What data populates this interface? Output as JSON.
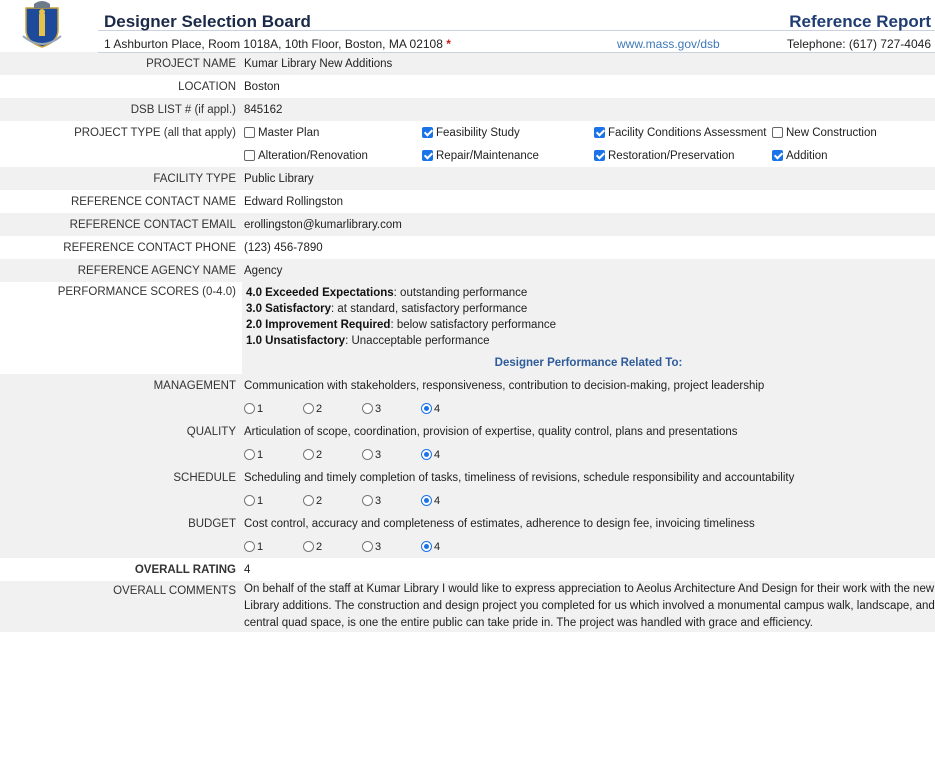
{
  "header": {
    "board_title": "Designer Selection Board",
    "report_title": "Reference Report",
    "address": "1 Ashburton Place, Room 1018A, 10th Floor, Boston, MA 02108",
    "asterisk": "*",
    "website": "www.mass.gov/dsb",
    "phone": "Telephone: (617) 727-4046"
  },
  "fields": {
    "project_name": {
      "label": "PROJECT NAME",
      "value": "Kumar Library New Additions"
    },
    "location": {
      "label": "LOCATION",
      "value": "Boston"
    },
    "dsb_list": {
      "label": "DSB LIST # (if appl.)",
      "value": "845162"
    },
    "project_type_label": "PROJECT TYPE (all that apply)",
    "facility_type": {
      "label": "FACILITY TYPE",
      "value": "Public Library"
    },
    "contact_name": {
      "label": "REFERENCE CONTACT NAME",
      "value": "Edward Rollingston"
    },
    "contact_email": {
      "label": "REFERENCE CONTACT EMAIL",
      "value": "erollingston@kumarlibrary.com"
    },
    "contact_phone": {
      "label": "REFERENCE CONTACT PHONE",
      "value": "(123) 456-7890"
    },
    "agency_name": {
      "label": "REFERENCE AGENCY NAME",
      "value": "Agency"
    },
    "performance_label": "PERFORMANCE SCORES (0-4.0)",
    "overall_rating": {
      "label": "OVERALL RATING",
      "value": "4"
    },
    "overall_comments": {
      "label": "OVERALL COMMENTS",
      "value": "On behalf of the staff at Kumar Library I would like to express appreciation to Aeolus Architecture And Design for their work with the new Library additions. The construction and design project you completed for us which involved a monumental campus walk, landscape, and central quad space, is one the entire public can take pride in. The project was handled with grace and efficiency."
    }
  },
  "project_types": [
    {
      "label": "Master Plan",
      "checked": false
    },
    {
      "label": "Feasibility Study",
      "checked": true
    },
    {
      "label": "Facility Conditions Assessment",
      "checked": true
    },
    {
      "label": "New Construction",
      "checked": false
    },
    {
      "label": "Alteration/Renovation",
      "checked": false
    },
    {
      "label": "Repair/Maintenance",
      "checked": true
    },
    {
      "label": "Restoration/Preservation",
      "checked": true
    },
    {
      "label": "Addition",
      "checked": true
    }
  ],
  "scores": [
    {
      "bold": "4.0 Exceeded Expectations",
      "text": ": outstanding performance"
    },
    {
      "bold": "3.0 Satisfactory",
      "text": ": at standard, satisfactory performance"
    },
    {
      "bold": "2.0 Improvement Required",
      "text": ": below satisfactory performance"
    },
    {
      "bold": "1.0 Unsatisfactory",
      "text": ": Unacceptable performance"
    }
  ],
  "performance_heading": "Designer Performance Related To:",
  "criteria": [
    {
      "label": "MANAGEMENT",
      "desc": "Communication with stakeholders, responsiveness, contribution to decision-making, project leadership",
      "selected": 4
    },
    {
      "label": "QUALITY",
      "desc": "Articulation of scope, coordination, provision of expertise, quality control, plans and presentations",
      "selected": 4
    },
    {
      "label": "SCHEDULE",
      "desc": "Scheduling and timely completion of tasks, timeliness of revisions, schedule responsibility and accountability",
      "selected": 4
    },
    {
      "label": "BUDGET",
      "desc": "Cost control, accuracy and completeness of estimates, adherence to design fee, invoicing timeliness",
      "selected": 4
    }
  ],
  "radio_options": [
    "1",
    "2",
    "3",
    "4"
  ],
  "colors": {
    "accent": "#1a73e8",
    "heading": "#1f3d73",
    "link": "#3f78b6",
    "asterisk": "#d21a1a"
  }
}
